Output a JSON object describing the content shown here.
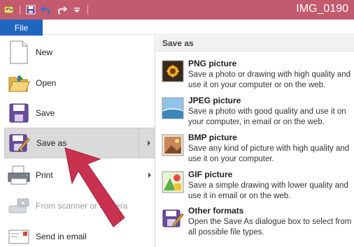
{
  "window": {
    "title": "IMG_0190"
  },
  "ribbon": {
    "file_tab": "File"
  },
  "menu": {
    "items": [
      {
        "label": "New",
        "icon": "new-document-icon"
      },
      {
        "label": "Open",
        "icon": "open-folder-icon"
      },
      {
        "label": "Save",
        "icon": "save-floppy-icon"
      },
      {
        "label": "Save as",
        "icon": "save-as-icon",
        "selected": true,
        "submenu": true
      },
      {
        "label": "Print",
        "icon": "printer-icon",
        "submenu": true
      },
      {
        "label": "From scanner or camera",
        "icon": "scanner-camera-icon",
        "disabled": true
      },
      {
        "label": "Send in email",
        "icon": "email-icon"
      }
    ]
  },
  "panel": {
    "header": "Save as",
    "options": [
      {
        "title": "PNG picture",
        "desc": "Save a photo or drawing with high quality and use it on your computer or on the web.",
        "icon": "png-picture-icon"
      },
      {
        "title": "JPEG picture",
        "desc": "Save a photo with good quality and use it on your computer, in email or on the web.",
        "icon": "jpeg-picture-icon"
      },
      {
        "title": "BMP picture",
        "desc": "Save any kind of picture with high quality and use it on your computer.",
        "icon": "bmp-picture-icon"
      },
      {
        "title": "GIF picture",
        "desc": "Save a simple drawing with lower quality and use it in email or on the web.",
        "icon": "gif-picture-icon"
      },
      {
        "title": "Other formats",
        "desc": "Open the Save As dialogue box to select from all possible file types.",
        "icon": "other-formats-icon"
      }
    ]
  },
  "colors": {
    "titlebar": "#c45a6d",
    "file_tab": "#1f66c1",
    "annotation_arrow": "#c8324e"
  }
}
